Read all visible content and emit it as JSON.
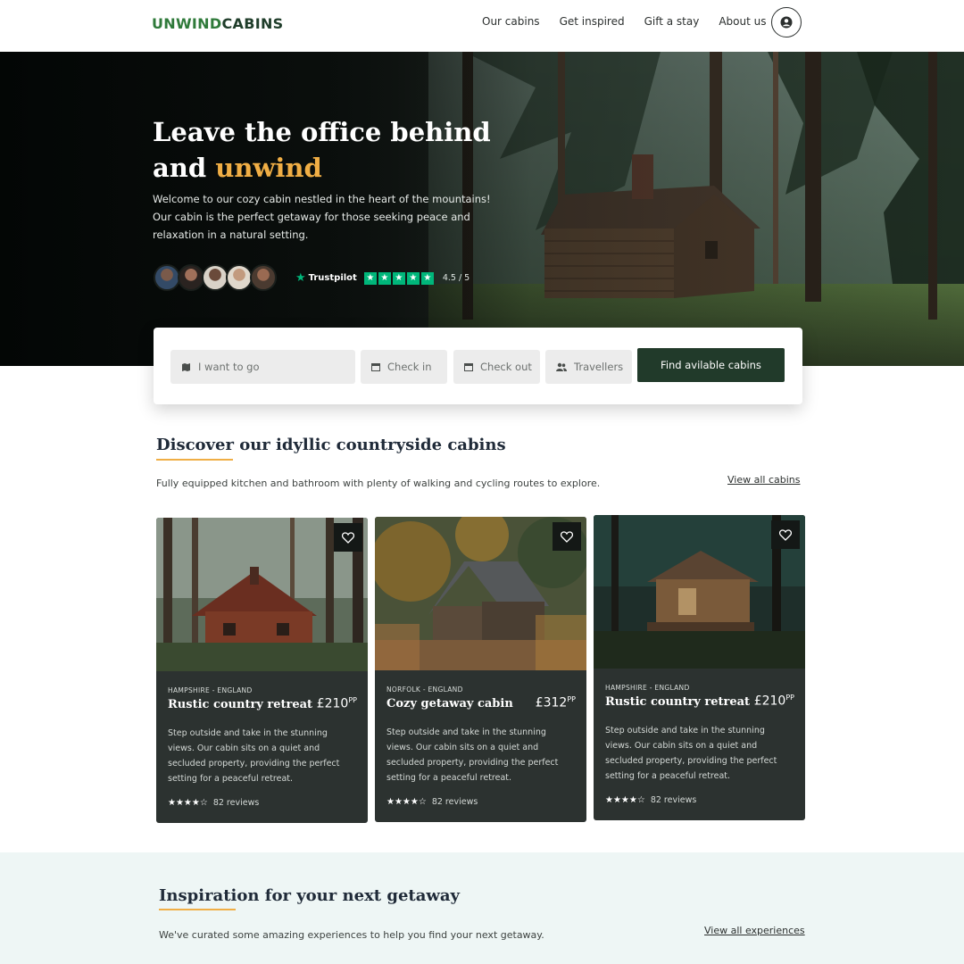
{
  "header": {
    "logo_part1": "UNWIND",
    "logo_part2": "CABINS",
    "nav": [
      "Our cabins",
      "Get inspired",
      "Gift a stay",
      "About us"
    ]
  },
  "hero": {
    "title_line1": "Leave the office behind",
    "title_line2_prefix": "and ",
    "title_accent": "unwind",
    "text": "Welcome to our cozy cabin nestled in the heart of the mountains! Our cabin is the perfect getaway for those seeking peace and relaxation in a natural setting.",
    "trustpilot_label": "Trustpilot",
    "rating": "4.5 / 5"
  },
  "search": {
    "destination_placeholder": "I want to go",
    "checkin_label": "Check in",
    "checkout_label": "Check out",
    "travellers_label": "Travellers",
    "submit_label": "Find avilable cabins"
  },
  "discover": {
    "title": "Discover our idyllic countryside cabins",
    "subtitle": "Fully equipped kitchen and bathroom with plenty of walking and cycling routes to explore.",
    "view_all": "View all cabins",
    "cards": [
      {
        "location": "HAMPSHIRE - ENGLAND",
        "name": "Rustic country retreat",
        "price": "£210",
        "price_unit": "PP",
        "description": "Step outside and take in the stunning views. Our cabin sits on a quiet and secluded property, providing the perfect setting for a peaceful retreat.",
        "stars": "★★★★☆",
        "reviews": "82 reviews"
      },
      {
        "location": "NORFOLK - ENGLAND",
        "name": "Cozy getaway cabin",
        "price": "£312",
        "price_unit": "PP",
        "description": "Step outside and take in the stunning views. Our cabin sits on a quiet and secluded property, providing the perfect setting for a peaceful retreat.",
        "stars": "★★★★☆",
        "reviews": "82 reviews"
      },
      {
        "location": "HAMPSHIRE - ENGLAND",
        "name": "Rustic country retreat",
        "price": "£210",
        "price_unit": "PP",
        "description": "Step outside and take in the stunning views. Our cabin sits on a quiet and secluded property, providing the perfect setting for a peaceful retreat.",
        "stars": "★★★★☆",
        "reviews": "82 reviews"
      }
    ]
  },
  "inspiration": {
    "title": "Inspiration for your next getaway",
    "subtitle": "We've curated some amazing experiences to help you find your next getaway.",
    "view_all": "View all experiences"
  },
  "colors": {
    "brand_dark": "#213a2a",
    "brand_green": "#2f7a3a",
    "accent": "#f0ae45",
    "card_bg": "#2c3230",
    "trustpilot": "#00b67a",
    "inspiration_bg": "#eef6f5"
  },
  "icons": [
    "user-icon",
    "map-icon",
    "calendar-icon",
    "users-icon",
    "heart-icon",
    "trustpilot-star-icon",
    "star-icon"
  ]
}
